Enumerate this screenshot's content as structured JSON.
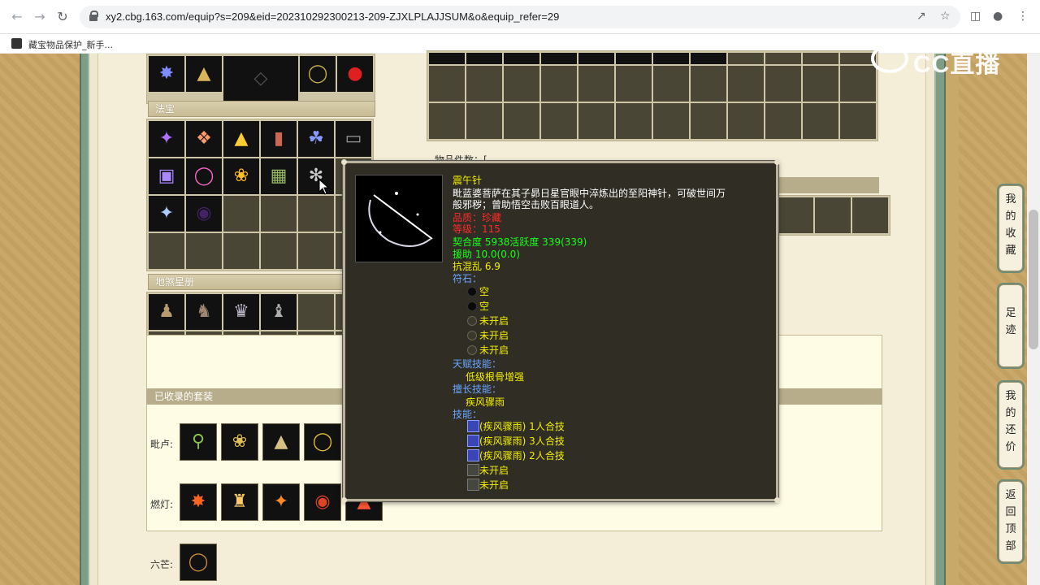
{
  "browser": {
    "url": "xy2.cbg.163.com/equip?s=209&eid=202310292300213-209-ZJXLPLAJJSUM&o&equip_refer=29",
    "bookmark_label": "藏宝物品保护_新手..."
  },
  "watermark": "CC直播",
  "sections": {
    "fabao": "法宝",
    "disha": "地煞星册",
    "suits": "已收录的套装",
    "partial": "物品件数：[",
    "suit_rows": [
      "毗卢:",
      "燃灯:",
      "六芒:"
    ]
  },
  "side_tabs": [
    {
      "label": [
        "我",
        "的",
        "收",
        "藏"
      ]
    },
    {
      "label": [
        "足",
        "迹"
      ]
    },
    {
      "label": [
        "我",
        "的",
        "还",
        "价"
      ]
    },
    {
      "label": [
        "返",
        "回",
        "顶",
        "部"
      ]
    }
  ],
  "tooltip": {
    "name": "震午针",
    "desc1": "毗蓝婆菩萨在其子昴日星官眼中淬炼出的至阳神针，可破世间万",
    "desc2": "般邪秽；曾助悟空击败百眼道人。",
    "quality": "品质：珍藏",
    "level": "等级：115",
    "fit": "契合度    5938活跃度    339(339)",
    "assist": "援助    10.0(0.0)",
    "resist": "抗混乱 6.9",
    "rune_title": "符石：",
    "runes": [
      "空",
      "空",
      "未开启",
      "未开启",
      "未开启"
    ],
    "talent_title": "天赋技能：",
    "talent": "低级根骨增强",
    "expert_title": "擅长技能：",
    "expert": "疾风骤雨",
    "skill_title": "技能：",
    "skills": [
      "(疾风骤雨) 1人合技",
      "(疾风骤雨) 3人合技",
      "(疾风骤雨) 2人合技",
      "未开启",
      "未开启"
    ]
  },
  "colors": {
    "tooltip_bg": "#2f2d24",
    "yellow": "#f4f000",
    "red": "#ff2a2a",
    "green": "#19ff19",
    "blue": "#6aa6ff"
  }
}
